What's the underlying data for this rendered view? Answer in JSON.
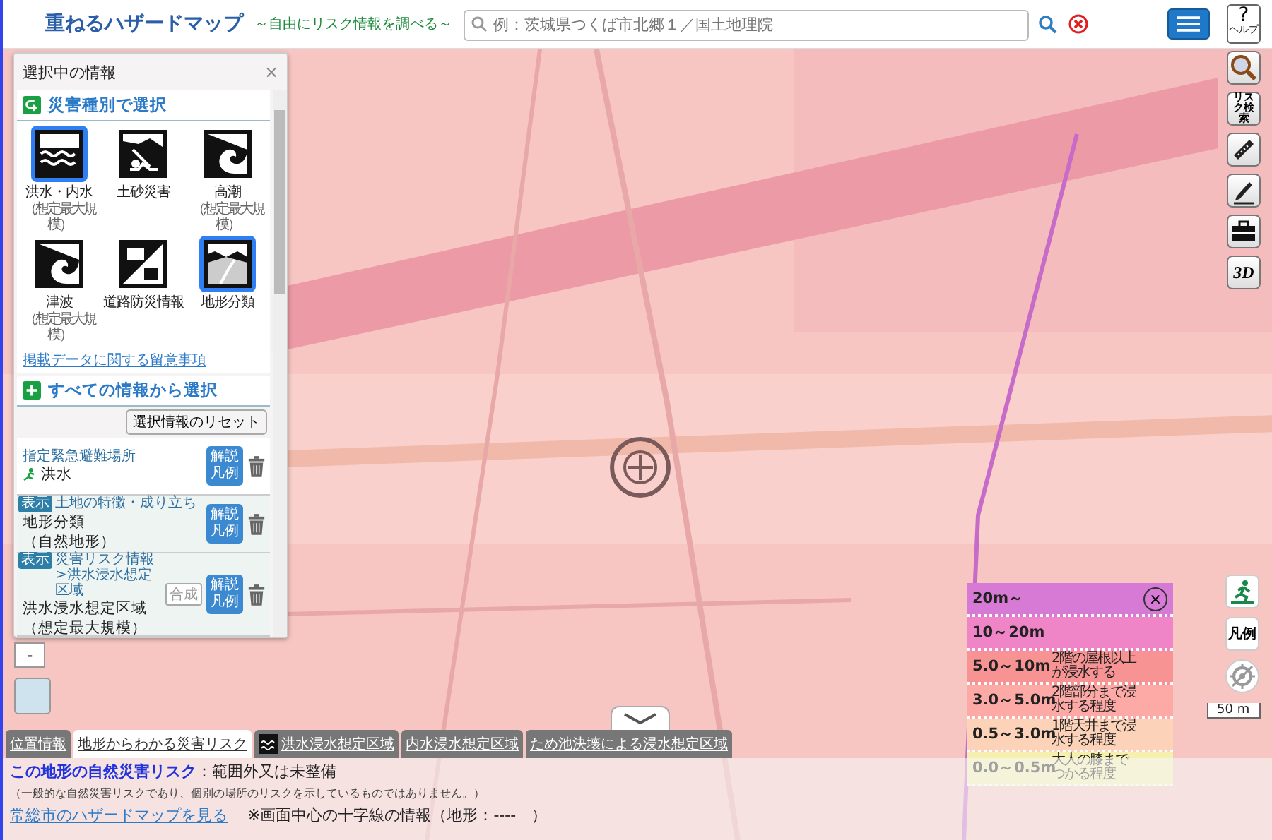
{
  "header": {
    "title": "重ねるハザードマップ",
    "subtitle": "～自由にリスク情報を調べる～",
    "search": {
      "placeholder": "例：茨城県つくば市北郷１／国土地理院"
    },
    "help": {
      "symbol": "?",
      "label": "ヘルプ"
    }
  },
  "panel": {
    "title": "選択中の情報",
    "close": "×",
    "hazard_section": "災害種別で選択",
    "hazards": [
      {
        "kind": "flood",
        "label": "洪水・内水",
        "note": "（想定最大規模）",
        "selected": true
      },
      {
        "kind": "landslide",
        "label": "土砂災害",
        "selected": false
      },
      {
        "kind": "surge",
        "label": "高潮",
        "note": "（想定最大規模）",
        "selected": false
      },
      {
        "kind": "tsunami",
        "label": "津波",
        "note": "（想定最大規模）",
        "selected": false
      },
      {
        "kind": "road",
        "label": "道路防災情報",
        "selected": false
      },
      {
        "kind": "terrain",
        "label": "地形分類",
        "selected": true
      }
    ],
    "notice_link": "掲載データに関する留意事項",
    "all_section": "すべての情報から選択",
    "reset": "選択情報のリセット",
    "layers": [
      {
        "category": "指定緊急避難場所",
        "name": "洪水",
        "legend_button": "解説凡例"
      },
      {
        "badge": "表示",
        "category": "土地の特徴・成り立ち",
        "name": "地形分類",
        "sub": "（自然地形）",
        "legend_button": "解説凡例"
      },
      {
        "badge": "表示",
        "category": "災害リスク情報>洪水浸水想定区域",
        "name": "洪水浸水想定区域",
        "sub": "（想定最大規模）",
        "combine": "合成",
        "legend_button": "解説凡例"
      }
    ]
  },
  "tools": [
    {
      "kind": "magnifier"
    },
    {
      "kind": "text",
      "label": "リスク検索"
    },
    {
      "kind": "ruler"
    },
    {
      "kind": "pencil"
    },
    {
      "kind": "toolbox"
    },
    {
      "kind": "text3d",
      "label": "3D"
    }
  ],
  "side_buttons": [
    {
      "kind": "runner"
    },
    {
      "kind": "text",
      "label": "凡例"
    },
    {
      "kind": "locate"
    }
  ],
  "zoom_out": "-",
  "scale": "50 m",
  "legend": {
    "close": "×",
    "bands": [
      {
        "label": "20m～",
        "color": "#d77ad6"
      },
      {
        "label": "10～20m",
        "color": "#ef84c6"
      },
      {
        "label": "5.0～10m",
        "desc": "2階の屋根以上が浸水する",
        "color": "#f79393"
      },
      {
        "label": "3.0～5.0m",
        "desc": "2階部分まで浸水する程度",
        "color": "#fdaaa6"
      },
      {
        "label": "0.5～3.0m",
        "desc": "1階天井まで浸水する程度",
        "color": "#fcd2b8"
      },
      {
        "label": "0.0～0.5m",
        "desc": "大人の膝までつかる程度",
        "color": "#f6f0b0"
      }
    ]
  },
  "tabs": [
    {
      "label": "位置情報",
      "selected": false
    },
    {
      "label": "地形からわかる災害リスク",
      "selected": true
    },
    {
      "label": "洪水浸水想定区域",
      "icon": true,
      "selected": false
    },
    {
      "label": "内水浸水想定区域",
      "selected": false
    },
    {
      "label": "ため池決壊による浸水想定区域",
      "selected": false
    }
  ],
  "info": {
    "risk": "**この地形の自然災害リスク**：範囲外又は未整備",
    "note": "（一般的な自然災害リスクであり、個別の場所のリスクを示しているものではありません。）",
    "link": "常総市のハザードマップを見る",
    "crosshair": "※画面中心の十字線の情報（地形：----　）"
  }
}
